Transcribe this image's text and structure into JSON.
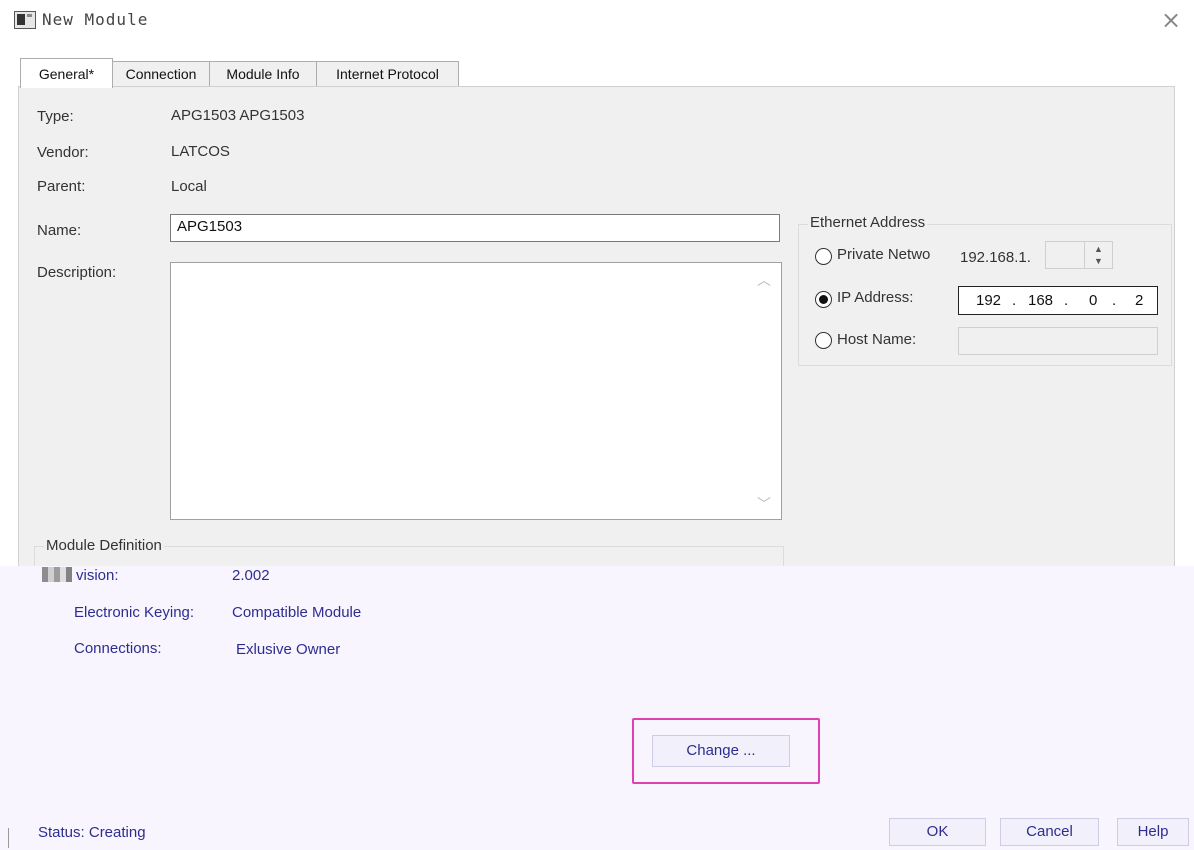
{
  "window": {
    "title": "New Module",
    "icon": "module-window-icon",
    "close_symbol": "×"
  },
  "tabs": [
    {
      "label": "General*",
      "active": true
    },
    {
      "label": "Connection",
      "active": false
    },
    {
      "label": "Module Info",
      "active": false
    },
    {
      "label": "Internet Protocol",
      "active": false
    }
  ],
  "general": {
    "type_label": "Type:",
    "type_value": "APG1503 APG1503",
    "vendor_label": "Vendor:",
    "vendor_value": "LATCOS",
    "parent_label": "Parent:",
    "parent_value": "Local",
    "name_label": "Name:",
    "name_value": "APG1503",
    "description_label": "Description:",
    "description_value": ""
  },
  "ethernet": {
    "group_label": "Ethernet Address",
    "private_label": "Private Netwo",
    "private_prefix": "192.168.1.",
    "ip_label": "IP Address:",
    "ip_segments": [
      "192",
      "168",
      "0",
      "2"
    ],
    "host_label": "Host Name:",
    "selected": "ip"
  },
  "module_definition": {
    "group_label": "Module Definition",
    "revision_label": "Revision:",
    "revision_visible_text": "vision:",
    "revision_value": "2.002",
    "keying_label": "Electronic Keying:",
    "keying_value": "Compatible Module",
    "connections_label": "Connections:",
    "connections_value": "Exlusive Owner",
    "change_button": "Change ..."
  },
  "footer": {
    "status_text": "Status: Creating",
    "ok_button": "OK",
    "cancel_button": "Cancel",
    "help_button": "Help"
  },
  "colors": {
    "panel": "#f0f0f0",
    "lower_panel": "#f8f5ff",
    "link_text": "#2d2d8f",
    "highlight": "#e040b0"
  }
}
